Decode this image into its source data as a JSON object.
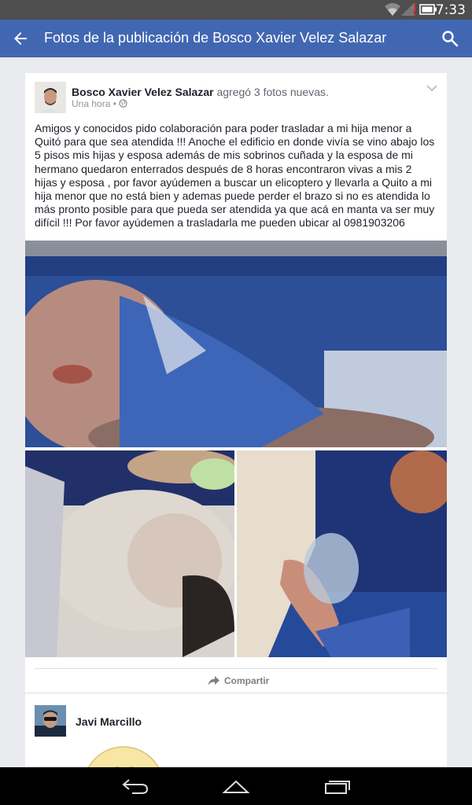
{
  "status_bar": {
    "time": "7:33"
  },
  "app_bar": {
    "title": "Fotos de la publicación de Bosco Xavier Velez Salazar"
  },
  "post": {
    "author": "Bosco Xavier Velez Salazar",
    "action": "agregó 3 fotos nuevas.",
    "timestamp": "Una hora",
    "separator": "•",
    "privacy_icon": "globe-icon",
    "text": "Amigos y conocidos pido colaboración para poder trasladar a  mi hija menor a Quitó para que sea atendida !!! Anoche el edificio en donde vivía se vino abajo los 5 pisos mis hijas y esposa además de mis sobrinos cuñada y la esposa de mi hermano quedaron enterrados después de 8 horas encontraron vivas a mis 2 hijas y esposa , por favor ayúdemen a buscar un elicoptero y llevarla a Quito a mi hija menor que no está bien y ademas puede perder el brazo si no es atendida lo más pronto posible para que pueda ser atendida ya que acá en manta va ser muy difícil !!! Por favor ayúdemen a trasladarla me pueden ubicar al 0981903206",
    "share_label": "Compartir"
  },
  "comment": {
    "author": "Javi Marcillo"
  },
  "colors": {
    "app_bar": "#4267b2",
    "status_bar": "#4e4e4e",
    "background": "#e9ebee"
  }
}
